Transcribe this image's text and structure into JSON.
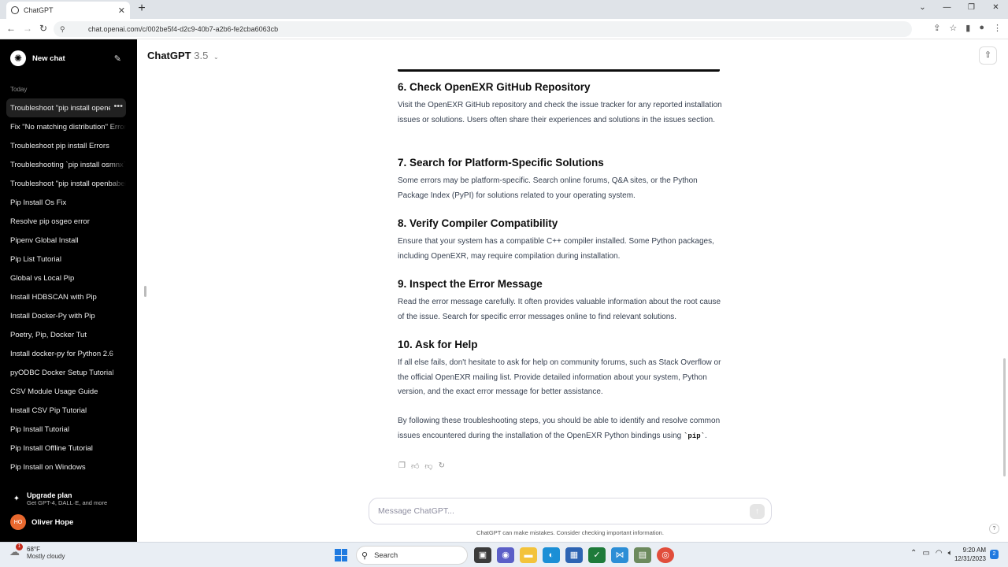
{
  "browser": {
    "tab_title": "ChatGPT",
    "url": "chat.openai.com/c/002be5f4-d2c9-40b7-a2b6-fe2cba6063cb"
  },
  "sidebar": {
    "new_chat": "New chat",
    "section_today": "Today",
    "history": [
      "Troubleshoot \"pip install openexr\"",
      "Fix \"No matching distribution\" Error",
      "Troubleshoot pip install Errors",
      "Troubleshooting `pip install osmnx`",
      "Troubleshoot \"pip install openbabel\"",
      "Pip Install Os Fix",
      "Resolve pip osgeo error",
      "Pipenv Global Install",
      "Pip List Tutorial",
      "Global vs Local Pip",
      "Install HDBSCAN with Pip",
      "Install Docker-Py with Pip",
      "Poetry, Pip, Docker Tut",
      "Install docker-py for Python 2.6",
      "pyODBC Docker Setup Tutorial",
      "CSV Module Usage Guide",
      "Install CSV Pip Tutorial",
      "Pip Install Tutorial",
      "Pip Install Offline Tutorial",
      "Pip Install on Windows"
    ],
    "upgrade_title": "Upgrade plan",
    "upgrade_sub": "Get GPT-4, DALL·E, and more",
    "user_initials": "HO",
    "user_name": "Oliver Hope"
  },
  "header": {
    "model_name": "ChatGPT",
    "model_version": "3.5"
  },
  "message": {
    "sections": [
      {
        "heading": "6. Check OpenEXR GitHub Repository",
        "body": "Visit the OpenEXR GitHub repository and check the issue tracker for any reported installation issues or solutions. Users often share their experiences and solutions in the issues section."
      },
      {
        "heading": "7. Search for Platform-Specific Solutions",
        "body": "Some errors may be platform-specific. Search online forums, Q&A sites, or the Python Package Index (PyPI) for solutions related to your operating system."
      },
      {
        "heading": "8. Verify Compiler Compatibility",
        "body": "Ensure that your system has a compatible C++ compiler installed. Some Python packages, including OpenEXR, may require compilation during installation."
      },
      {
        "heading": "9. Inspect the Error Message",
        "body": "Read the error message carefully. It often provides valuable information about the root cause of the issue. Search for specific error messages online to find relevant solutions."
      },
      {
        "heading": "10. Ask for Help",
        "body": "If all else fails, don't hesitate to ask for help on community forums, such as Stack Overflow or the official OpenEXR mailing list. Provide detailed information about your system, Python version, and the exact error message for better assistance."
      }
    ],
    "closing_text": "By following these troubleshooting steps, you should be able to identify and resolve common issues encountered during the installation of the OpenEXR Python bindings using",
    "closing_code": "`pip`",
    "closing_end": "."
  },
  "composer": {
    "placeholder": "Message ChatGPT...",
    "disclaimer": "ChatGPT can make mistakes. Consider checking important information."
  },
  "taskbar": {
    "temperature": "68°F",
    "weather": "Mostly cloudy",
    "weather_badge": "1",
    "search": "Search",
    "time": "9:20 AM",
    "date": "12/31/2023",
    "notifications": "2"
  }
}
